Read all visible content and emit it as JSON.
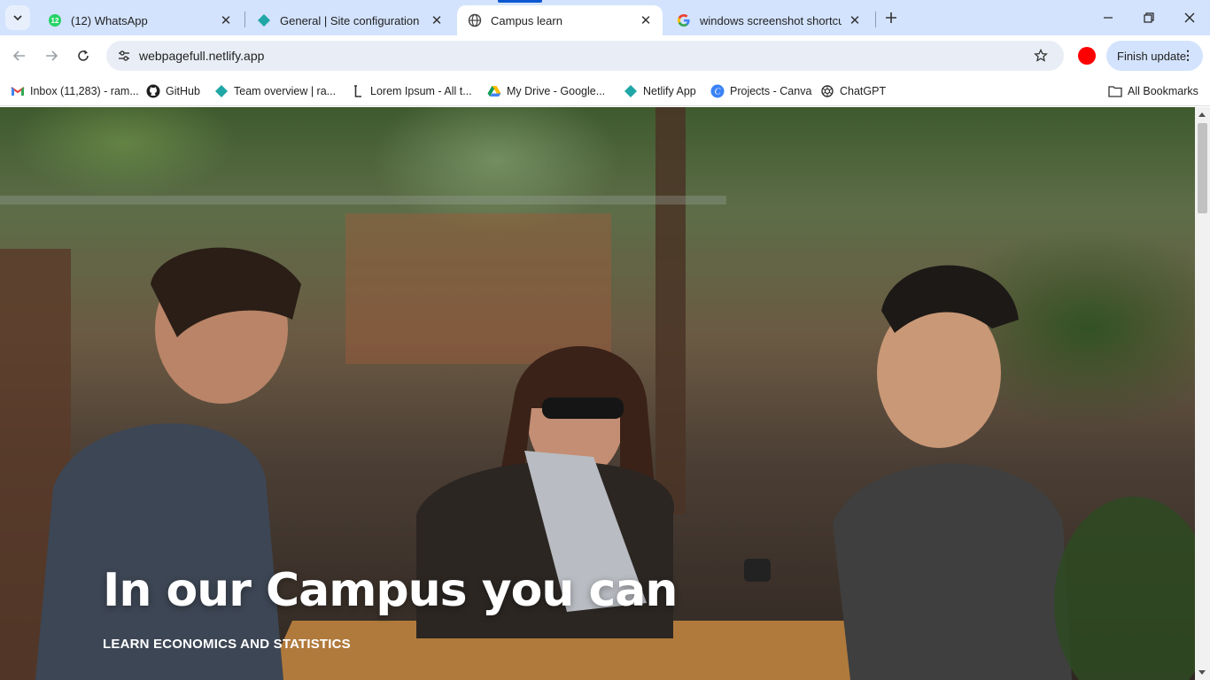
{
  "tabs": [
    {
      "title": "(12) WhatsApp",
      "icon": "whatsapp-icon",
      "badge": "12",
      "active": false
    },
    {
      "title": "General | Site configuration | we",
      "icon": "netlify-icon",
      "active": false
    },
    {
      "title": "Campus learn",
      "icon": "globe-icon",
      "active": true
    },
    {
      "title": "windows screenshot shortcut - ",
      "icon": "google-icon",
      "active": false
    }
  ],
  "toolbar": {
    "url": "webpagefull.netlify.app",
    "finish_update": "Finish update",
    "profile_color": "#ff0000"
  },
  "bookmarks": [
    {
      "label": "Inbox (11,283) - ram...",
      "icon": "gmail-icon"
    },
    {
      "label": "GitHub",
      "icon": "github-icon"
    },
    {
      "label": "Team overview | ra...",
      "icon": "netlify-icon"
    },
    {
      "label": "Lorem Ipsum - All t...",
      "icon": "lorem-icon"
    },
    {
      "label": "My Drive - Google...",
      "icon": "google-drive-icon"
    },
    {
      "label": "Netlify App",
      "icon": "netlify-icon"
    },
    {
      "label": "Projects - Canva",
      "icon": "canva-icon"
    },
    {
      "label": "ChatGPT",
      "icon": "chatgpt-icon"
    }
  ],
  "all_bookmarks": "All Bookmarks",
  "hero": {
    "title": "In our Campus you can",
    "subtitle": "LEARN ECONOMICS AND STATISTICS"
  },
  "colors": {
    "tabstrip": "#d3e3fd",
    "accent": "#0b57d0"
  }
}
